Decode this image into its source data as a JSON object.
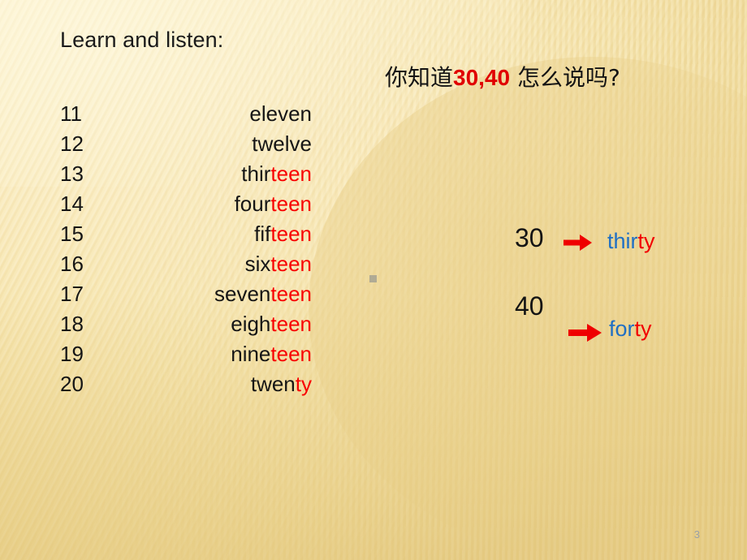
{
  "slide": {
    "title": "Learn and listen:",
    "page_number": "3",
    "background_color": "#f7e6ad",
    "accent_red": "#f80000",
    "accent_blue": "#1f6fc4",
    "text_color": "#151515"
  },
  "question": {
    "prefix": "你知道",
    "highlight": "30,40",
    "suffix": " 怎么说吗?",
    "highlight_color": "#e00000"
  },
  "number_list": [
    {
      "numeral": "11",
      "prefix": "eleven",
      "suffix": ""
    },
    {
      "numeral": "12",
      "prefix": "twelve",
      "suffix": ""
    },
    {
      "numeral": "13",
      "prefix": "thir",
      "suffix": "teen"
    },
    {
      "numeral": "14",
      "prefix": "four",
      "suffix": "teen"
    },
    {
      "numeral": "15",
      "prefix": "fif",
      "suffix": "teen"
    },
    {
      "numeral": "16",
      "prefix": "six",
      "suffix": "teen"
    },
    {
      "numeral": "17",
      "prefix": "seven",
      "suffix": "teen"
    },
    {
      "numeral": "18",
      "prefix": "eigh",
      "suffix": "teen"
    },
    {
      "numeral": "19",
      "prefix": "nine",
      "suffix": "teen"
    },
    {
      "numeral": "20",
      "prefix": "twen",
      "suffix": "ty"
    }
  ],
  "tens": [
    {
      "numeral": "30",
      "head": "thir",
      "tail": "ty",
      "arrow": "right-arrow-icon"
    },
    {
      "numeral": "40",
      "head": "for",
      "tail": "ty",
      "arrow": "right-arrow-icon"
    }
  ]
}
